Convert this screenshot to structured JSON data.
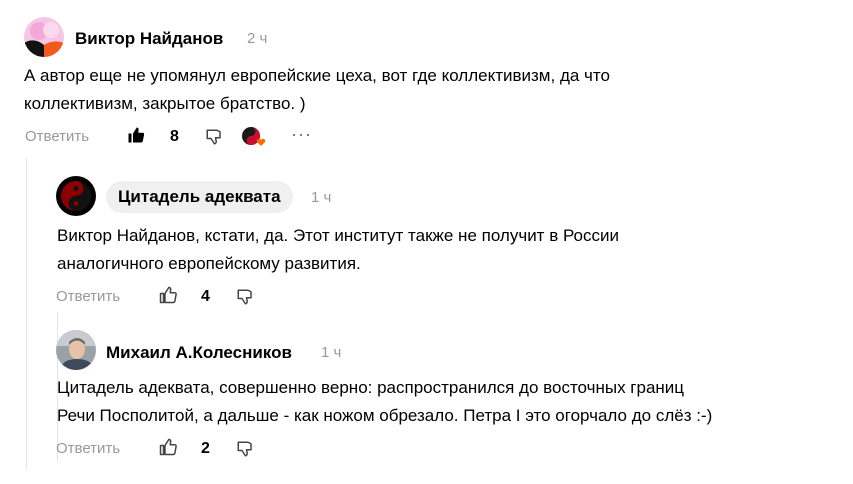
{
  "comments": [
    {
      "author": "Виктор Найданов",
      "time": "2 ч",
      "text_lines": [
        "А автор еще не упомянул европейские цеха, вот где коллективизм, да что",
        "коллективизм, закрытое братство. )"
      ],
      "reply_label": "Ответить",
      "likes": "8",
      "liked": true,
      "more": "···"
    },
    {
      "author": "Цитадель адеквата",
      "time": "1 ч",
      "text_lines": [
        "Виктор Найданов, кстати, да. Этот институт также не получит в России",
        "аналогичного европейскому развития."
      ],
      "reply_label": "Ответить",
      "likes": "4",
      "liked": false
    },
    {
      "author": "Михаил А.Колесников",
      "time": "1 ч",
      "text_lines": [
        "Цитадель адеквата, совершенно верно: распространился до восточных границ",
        "Речи Посполитой, а дальше - как ножом обрезало. Петра I это огорчало до слёз :-)"
      ],
      "reply_label": "Ответить",
      "likes": "2",
      "liked": false
    }
  ],
  "colors": {
    "muted": "#999999",
    "chip_bg": "#f0f0f0",
    "reaction_red": "#c8102e",
    "reaction_orange": "#ff6a00"
  }
}
